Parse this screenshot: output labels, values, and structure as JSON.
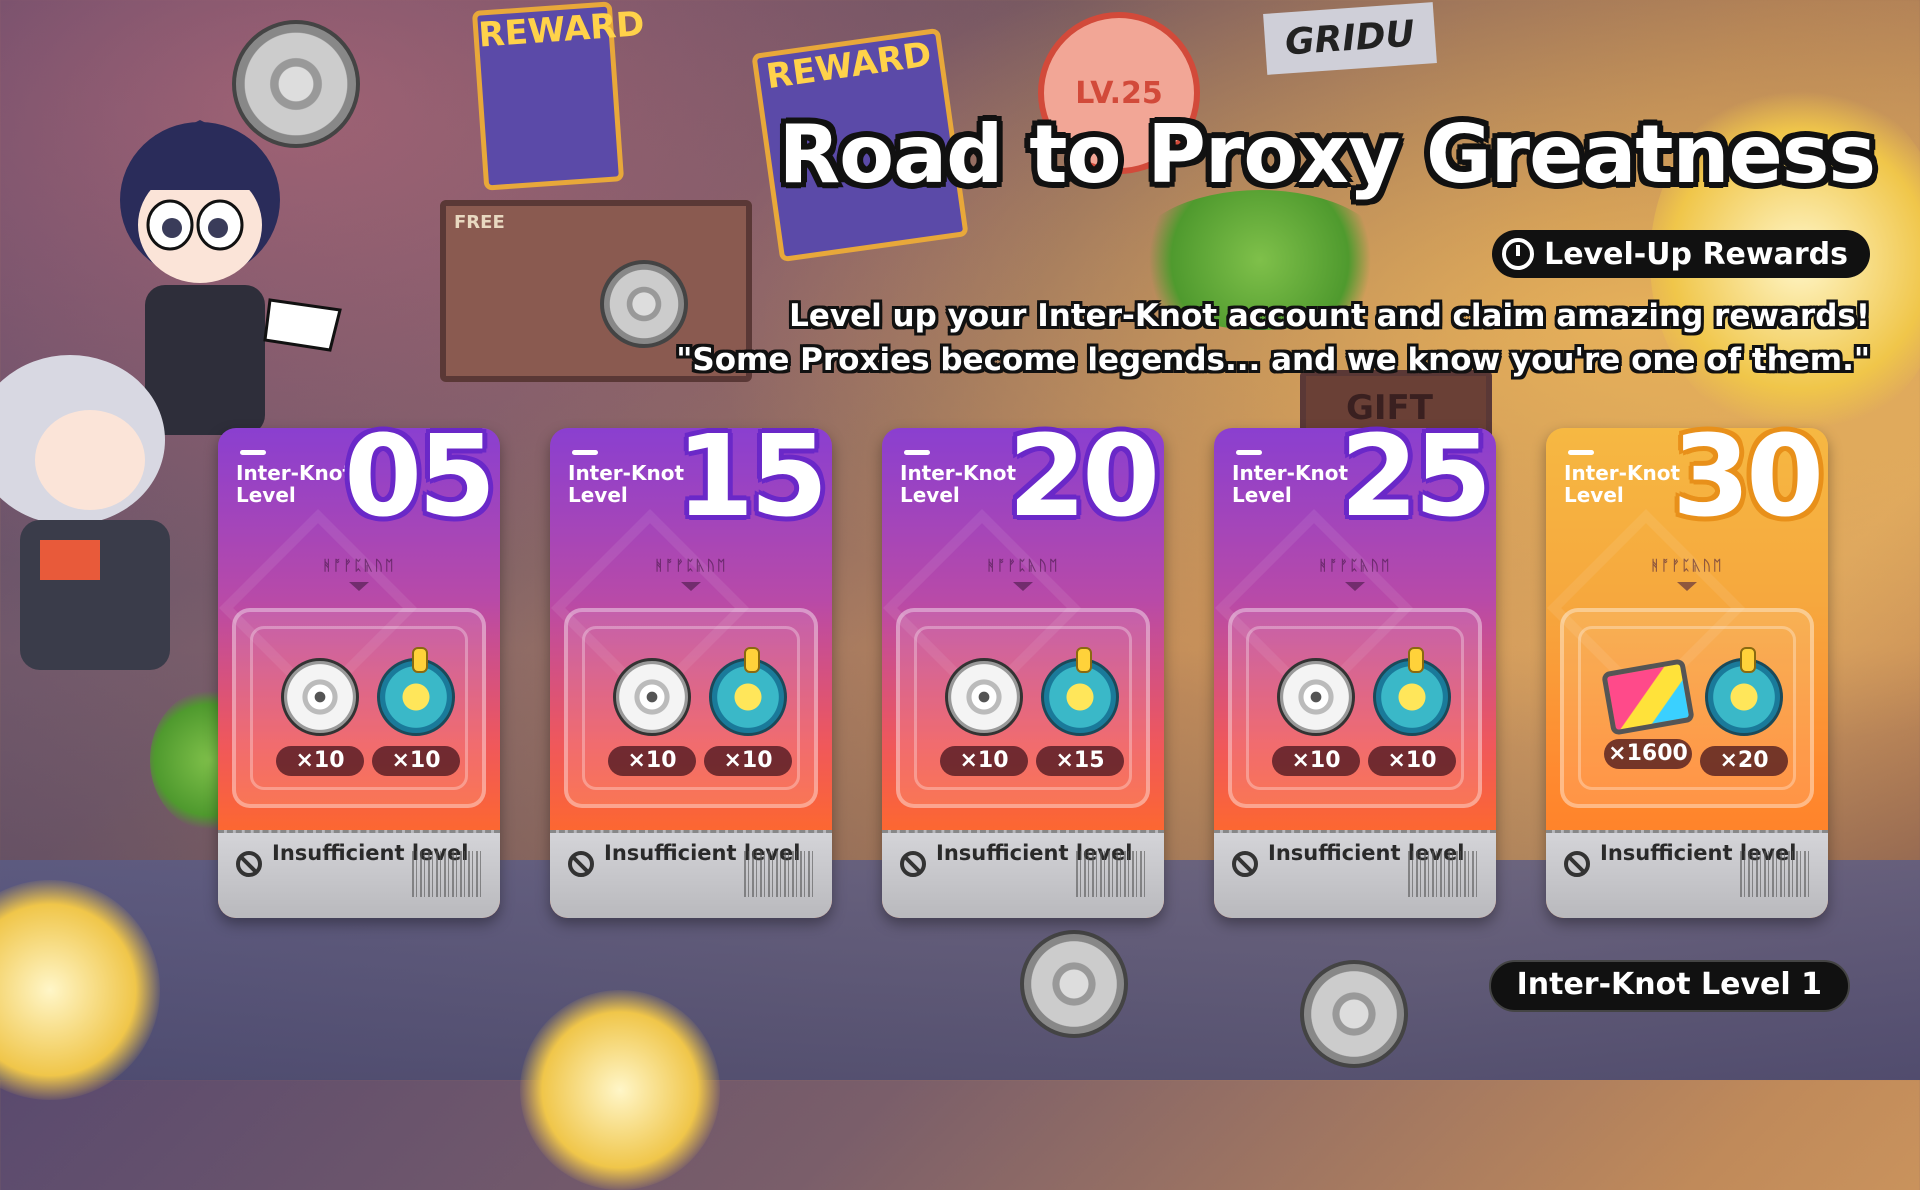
{
  "header": {
    "title": "Road to Proxy Greatness",
    "tag": "Level-Up Rewards",
    "desc_line1": "Level up your Inter-Knot account and claim amazing rewards!",
    "desc_line2": "\"Some Proxies become legends... and we know you're one of them.\""
  },
  "background": {
    "poster1": "REWARD",
    "poster2": "REWARD",
    "badge": "LV.25",
    "sign": "GRIDU",
    "gift": "GIFT",
    "free": "FREE"
  },
  "cards": [
    {
      "label": "Inter-Knot Level",
      "level": "05",
      "item1_icon": "film-reel-icon",
      "item1_qty": "×10",
      "item2_icon": "bangboo-pack-icon",
      "item2_qty": "×10",
      "status": "Insufficient level"
    },
    {
      "label": "Inter-Knot Level",
      "level": "15",
      "item1_icon": "film-reel-icon",
      "item1_qty": "×10",
      "item2_icon": "bangboo-pack-icon",
      "item2_qty": "×10",
      "status": "Insufficient level"
    },
    {
      "label": "Inter-Knot Level",
      "level": "20",
      "item1_icon": "film-reel-icon",
      "item1_qty": "×10",
      "item2_icon": "bangboo-pack-icon",
      "item2_qty": "×15",
      "status": "Insufficient level"
    },
    {
      "label": "Inter-Knot Level",
      "level": "25",
      "item1_icon": "film-reel-icon",
      "item1_qty": "×10",
      "item2_icon": "bangboo-pack-icon",
      "item2_qty": "×10",
      "status": "Insufficient level"
    },
    {
      "label": "Inter-Knot Level",
      "level": "30",
      "item1_icon": "film-negative-icon",
      "item1_qty": "×1600",
      "item2_icon": "bangboo-pack-icon",
      "item2_qty": "×20",
      "status": "Insufficient level"
    }
  ],
  "card_glyph": "ᚻᚩᚠᛈᚣᚢᛖ",
  "current_level": "Inter-Knot Level  1",
  "colors": {
    "purple_card": "#8a3fd0",
    "orange_card": "#ff6a2a",
    "gold_card": "#f6b842",
    "dark_pill": "#111111"
  }
}
